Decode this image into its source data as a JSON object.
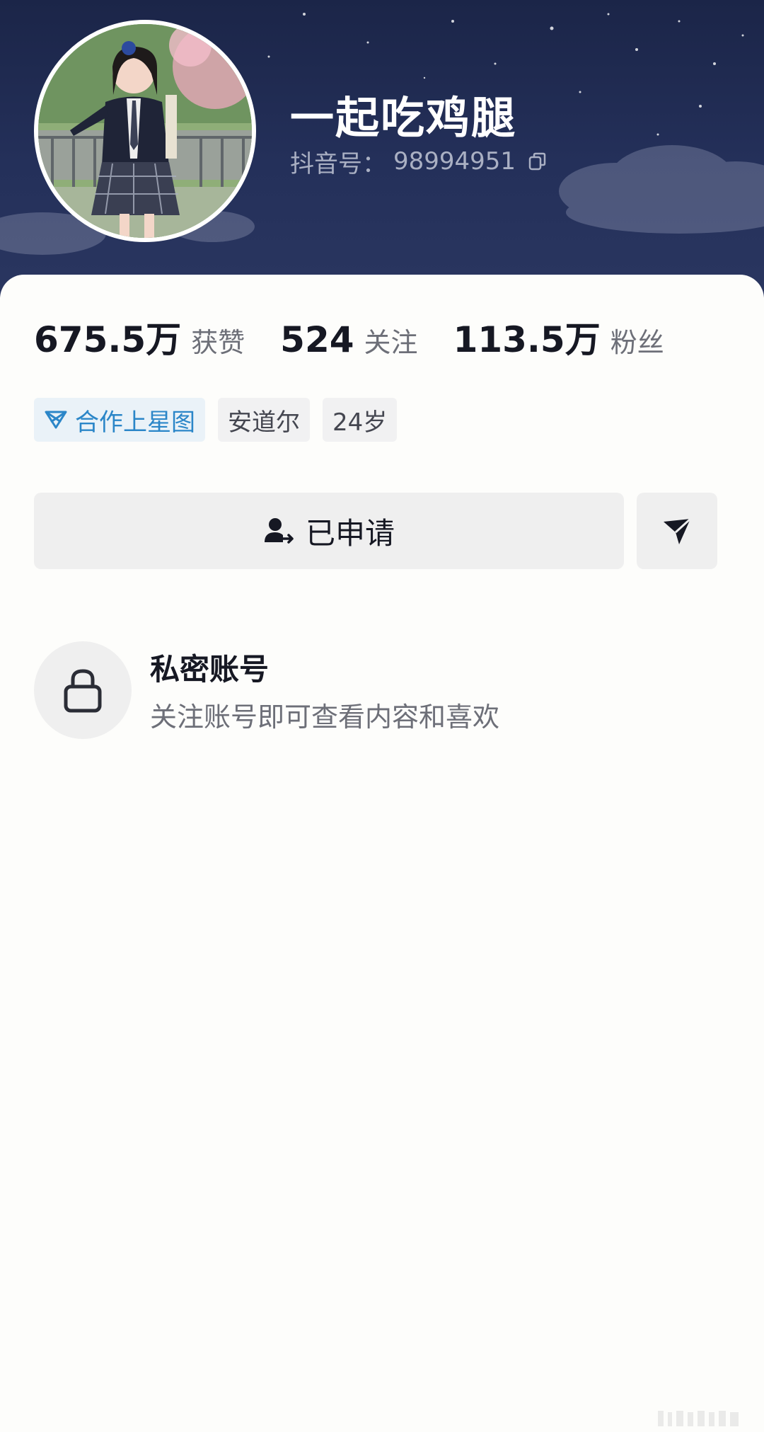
{
  "profile": {
    "username": "一起吃鸡腿",
    "douyin_id_label": "抖音号：",
    "douyin_id_value": "98994951",
    "avatar_icon": "avatar-photo"
  },
  "stats": {
    "likes": {
      "value": "675.5万",
      "label": "获赞"
    },
    "following": {
      "value": "524",
      "label": "关注"
    },
    "followers": {
      "value": "113.5万",
      "label": "粉丝"
    }
  },
  "tags": {
    "xingtu": {
      "label": "合作上星图",
      "icon": "xingtu-star-icon",
      "color": "#2b86c8"
    },
    "location": {
      "label": "安道尔"
    },
    "age": {
      "label": "24岁"
    }
  },
  "actions": {
    "applied_label": "已申请",
    "applied_icon": "user-pending-icon",
    "share_icon": "send-icon"
  },
  "private_account": {
    "title": "私密账号",
    "description": "关注账号即可查看内容和喜欢",
    "icon": "lock-icon"
  },
  "colors": {
    "header_bg": "#1b2548",
    "card_bg": "#fdfdfb",
    "accent_blue": "#2b86c8",
    "text_primary": "#161823",
    "text_secondary": "#6d6f78"
  }
}
